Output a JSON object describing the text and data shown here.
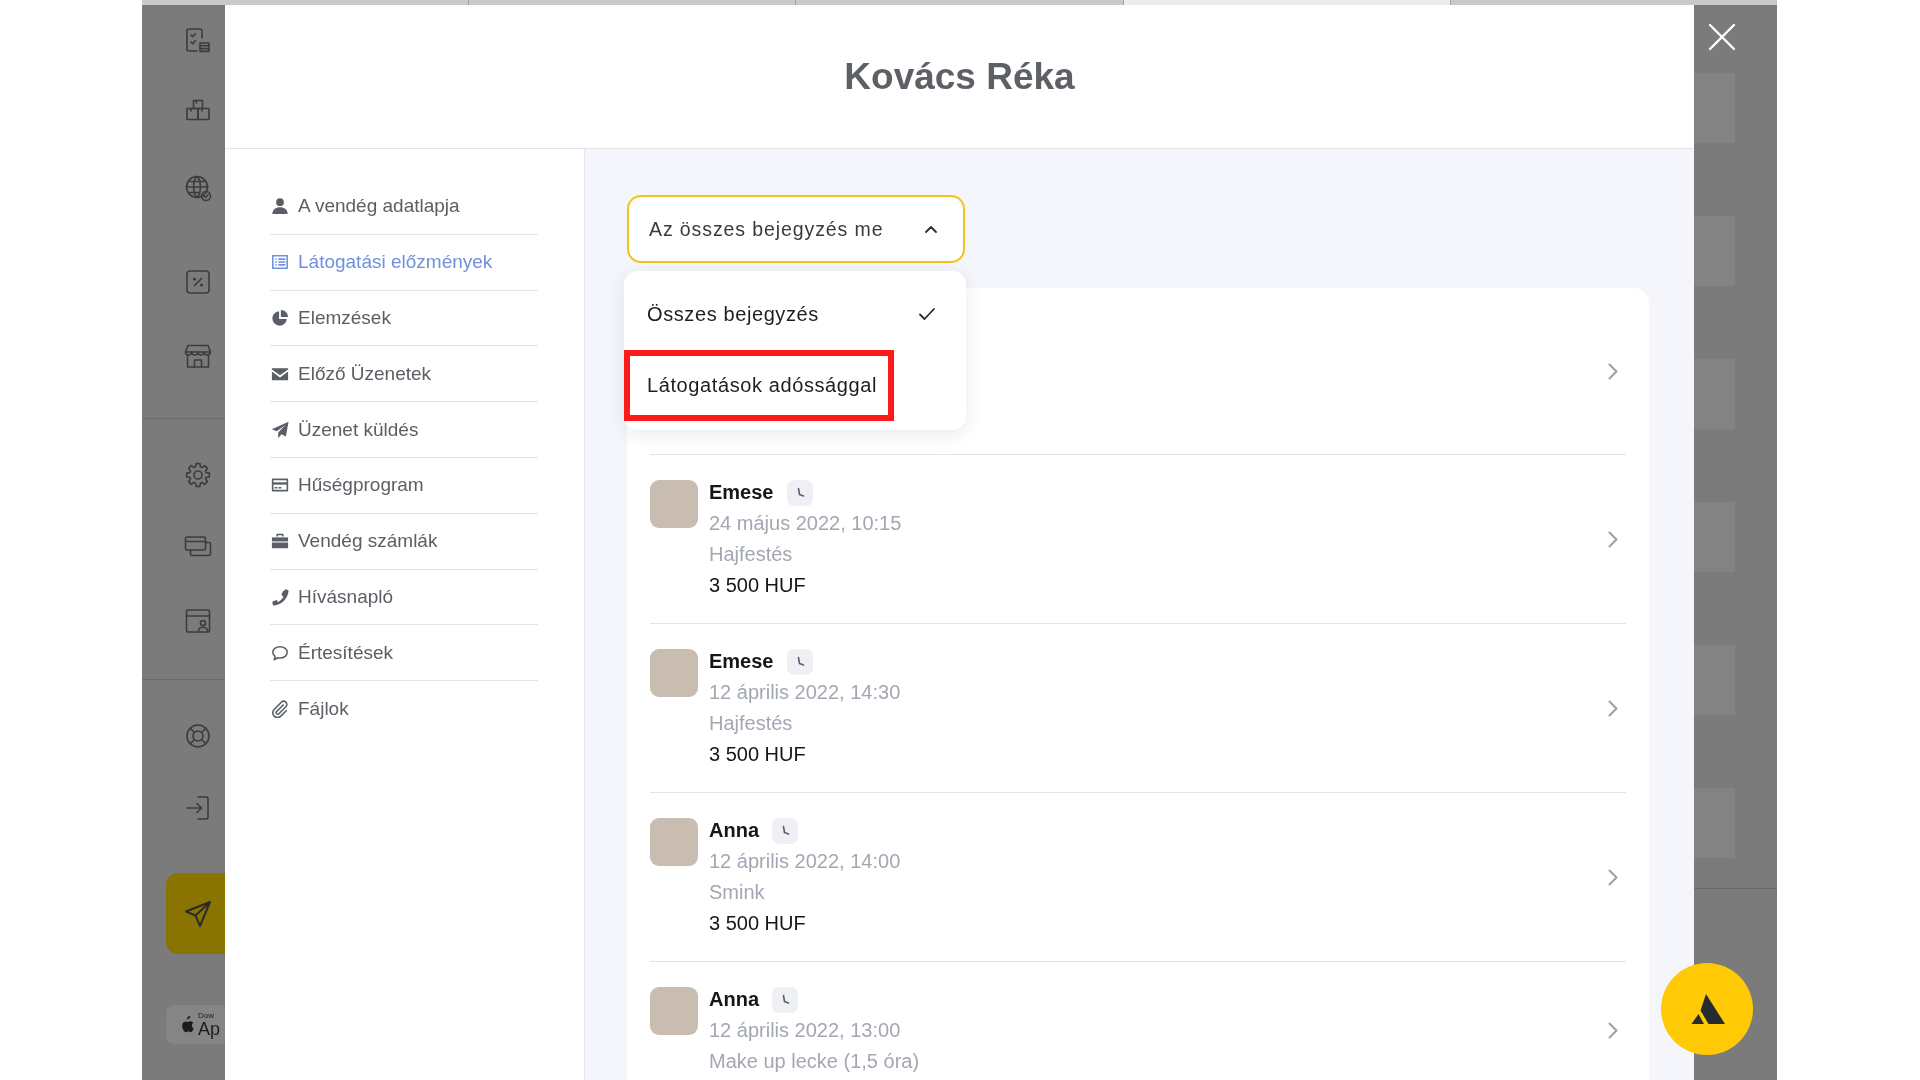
{
  "background": {
    "app_store_badge": {
      "caption": "Dow",
      "store": "Ap"
    }
  },
  "modal": {
    "title": "Kovács Réka"
  },
  "nav": {
    "items": [
      {
        "label": "A vendég adatlapja",
        "selected": false
      },
      {
        "label": "Látogatási előzmények",
        "selected": true
      },
      {
        "label": "Elemzések",
        "selected": false
      },
      {
        "label": "Előző Üzenetek",
        "selected": false
      },
      {
        "label": "Üzenet küldés",
        "selected": false
      },
      {
        "label": "Hűségprogram",
        "selected": false
      },
      {
        "label": "Vendég számlák",
        "selected": false
      },
      {
        "label": "Hívásnapló",
        "selected": false
      },
      {
        "label": "Értesítések",
        "selected": false
      },
      {
        "label": "Fájlok",
        "selected": false
      }
    ]
  },
  "visits": {
    "filter": {
      "value": "Az összes bejegyzés me",
      "expanded": true,
      "options": [
        {
          "label": "Összes bejegyzés",
          "selected": true,
          "highlighted": false
        },
        {
          "label": "Látogatások adóssággal",
          "selected": false,
          "highlighted": true
        }
      ]
    },
    "rows": [
      {
        "kind": "covered"
      },
      {
        "kind": "visit",
        "staff": "Emese",
        "datetime": "24 május 2022, 10:15",
        "service": "Hajfestés",
        "price": "3 500 HUF"
      },
      {
        "kind": "visit",
        "staff": "Emese",
        "datetime": "12 április 2022, 14:30",
        "service": "Hajfestés",
        "price": "3 500 HUF"
      },
      {
        "kind": "visit",
        "staff": "Anna",
        "datetime": "12 április 2022, 14:00",
        "service": "Smink",
        "price": "3 500 HUF"
      },
      {
        "kind": "visit",
        "staff": "Anna",
        "datetime": "12 április 2022, 13:00",
        "service": "Make up lecke (1,5 óra)"
      }
    ]
  }
}
